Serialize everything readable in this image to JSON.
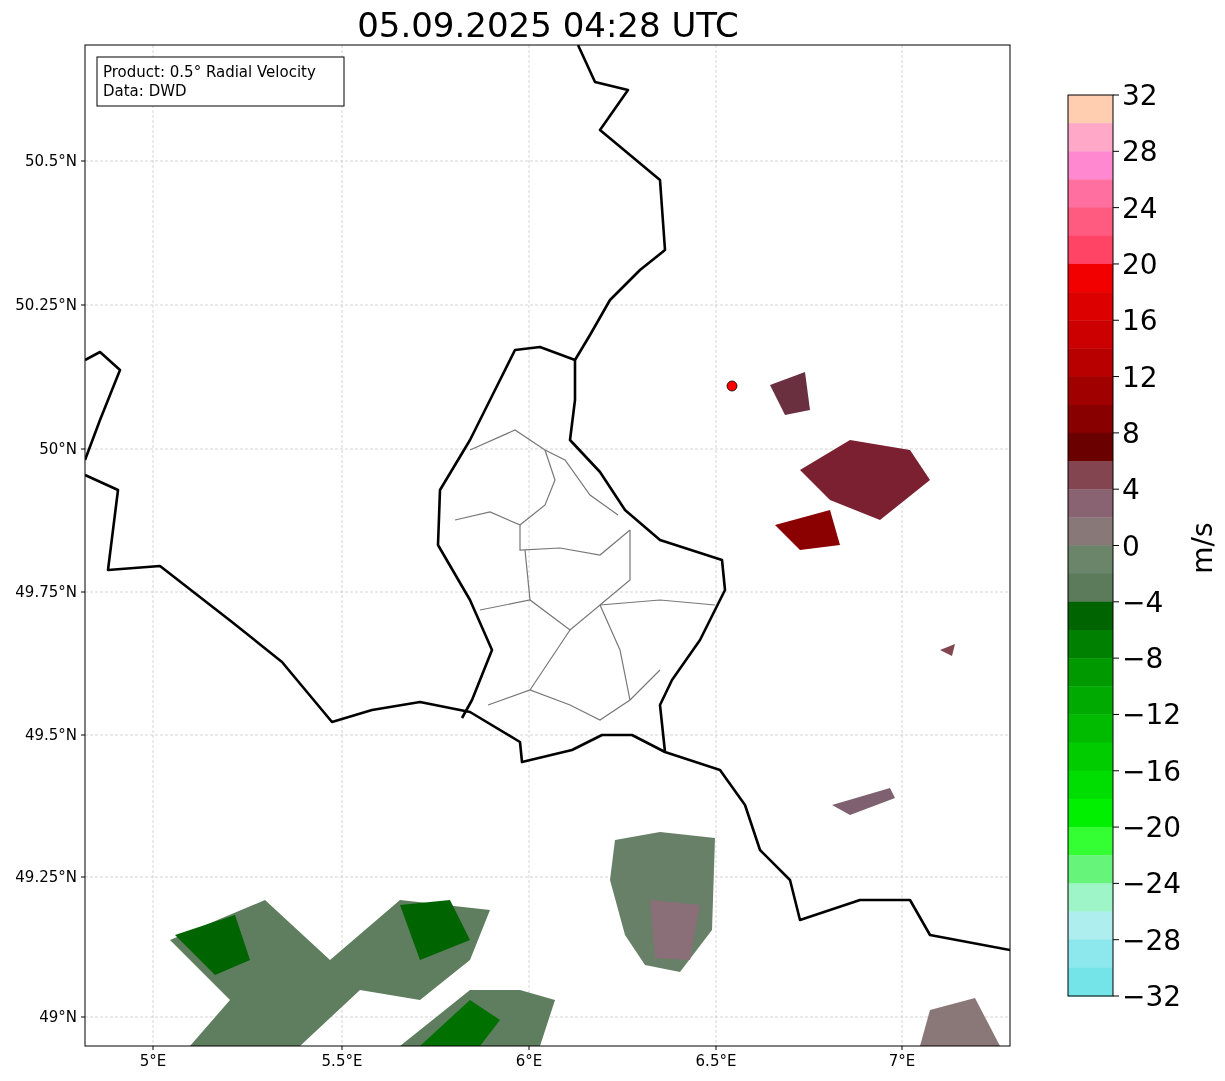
{
  "title": "05.09.2025 04:28 UTC",
  "info_box": {
    "lines": [
      "Product: 0.5° Radial Velocity",
      "Data: DWD"
    ]
  },
  "map": {
    "lat_labels": [
      "50.5°N",
      "50.25°N",
      "50°N",
      "49.75°N",
      "49.5°N",
      "49.25°N",
      "49°N"
    ],
    "lon_labels": [
      "5°E",
      "5.5°E",
      "6°E",
      "6.5°E",
      "7°E"
    ]
  },
  "colorbar": {
    "label": "m/s",
    "ticks": [
      "32",
      "28",
      "24",
      "20",
      "16",
      "12",
      "8",
      "4",
      "0",
      "−4",
      "−8",
      "−12",
      "−16",
      "−20",
      "−24",
      "−28",
      "−32"
    ],
    "bins": [
      {
        "color": "#ffceb0"
      },
      {
        "color": "#ffa8c8"
      },
      {
        "color": "#ff88d0"
      },
      {
        "color": "#ff70a0"
      },
      {
        "color": "#ff5a80"
      },
      {
        "color": "#ff4466"
      },
      {
        "color": "#f20000"
      },
      {
        "color": "#dd0000"
      },
      {
        "color": "#cc0000"
      },
      {
        "color": "#b80000"
      },
      {
        "color": "#a00000"
      },
      {
        "color": "#880000"
      },
      {
        "color": "#6a0000"
      },
      {
        "color": "#834550"
      },
      {
        "color": "#8a6372"
      },
      {
        "color": "#887878"
      },
      {
        "color": "#6b856b"
      },
      {
        "color": "#5b7b5b"
      },
      {
        "color": "#006400"
      },
      {
        "color": "#008000"
      },
      {
        "color": "#009900"
      },
      {
        "color": "#00aa00"
      },
      {
        "color": "#00bb00"
      },
      {
        "color": "#00cc00"
      },
      {
        "color": "#00dd00"
      },
      {
        "color": "#00f000"
      },
      {
        "color": "#33ff33"
      },
      {
        "color": "#66f47a"
      },
      {
        "color": "#9ef5c8"
      },
      {
        "color": "#aeeeee"
      },
      {
        "color": "#8ce8ec"
      },
      {
        "color": "#74e4e8"
      }
    ]
  }
}
